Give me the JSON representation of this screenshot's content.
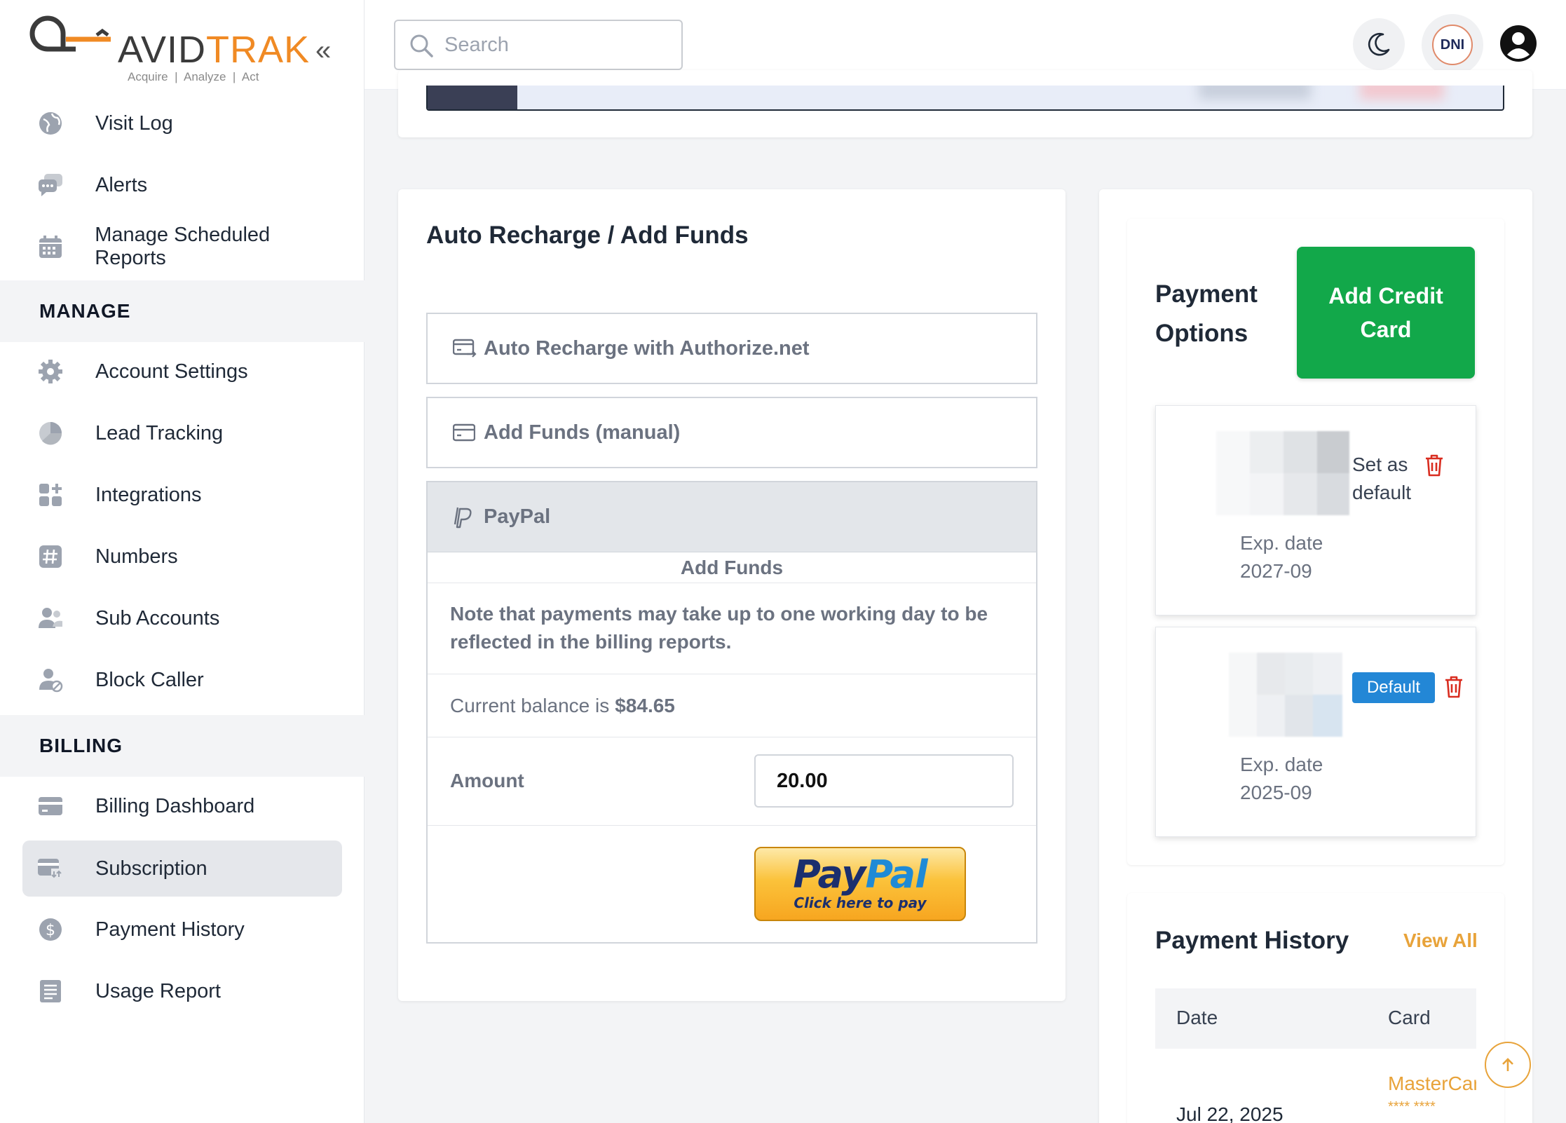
{
  "brand": {
    "name_part1": "AVID",
    "name_part2": "TRAK",
    "tagline": "Acquire  |  Analyze  |  Act"
  },
  "sidebar": {
    "collapse_label": "«",
    "top_items": [
      {
        "label": "Visit Log",
        "icon": "globe-icon"
      },
      {
        "label": "Alerts",
        "icon": "chat-bubbles-icon"
      },
      {
        "label": "Manage Scheduled Reports",
        "icon": "calendar-icon"
      }
    ],
    "manage_header": "MANAGE",
    "manage_items": [
      {
        "label": "Account Settings",
        "icon": "gear-icon"
      },
      {
        "label": "Lead Tracking",
        "icon": "pie-chart-icon"
      },
      {
        "label": "Integrations",
        "icon": "apps-icon"
      },
      {
        "label": "Numbers",
        "icon": "hash-icon"
      },
      {
        "label": "Sub Accounts",
        "icon": "users-icon"
      },
      {
        "label": "Block Caller",
        "icon": "user-block-icon"
      }
    ],
    "billing_header": "BILLING",
    "billing_items": [
      {
        "label": "Billing Dashboard",
        "icon": "credit-card-icon"
      },
      {
        "label": "Subscription",
        "icon": "card-transfer-icon",
        "active": true
      },
      {
        "label": "Payment History",
        "icon": "dollar-circle-icon"
      },
      {
        "label": "Usage Report",
        "icon": "list-icon"
      }
    ]
  },
  "topbar": {
    "search_placeholder": "Search",
    "dni_label": "DNI"
  },
  "recharge": {
    "title": "Auto Recharge / Add Funds",
    "option_authorize": "Auto Recharge with Authorize.net",
    "option_manual": "Add Funds (manual)",
    "option_paypal": "PayPal",
    "paypal_sub": "Add Funds",
    "note": "Note that payments may take up to one working day to be reflected in the billing reports.",
    "balance_prefix": "Current balance is",
    "balance_value": "$84.65",
    "amount_label": "Amount",
    "amount_value": "20.00",
    "paypal_logo_1": "Pay",
    "paypal_logo_2": "Pal",
    "paypal_click": "Click here to pay"
  },
  "payment_options": {
    "title": "Payment Options",
    "add_button": "Add Credit Card",
    "cards": [
      {
        "set_default_label": "Set as default",
        "exp_label": "Exp. date",
        "exp_value": "2027-09",
        "is_default": false
      },
      {
        "default_badge": "Default",
        "exp_label": "Exp. date",
        "exp_value": "2025-09",
        "is_default": true
      }
    ]
  },
  "payment_history": {
    "title": "Payment History",
    "view_all": "View All",
    "columns": [
      "Date",
      "Card"
    ],
    "rows": [
      {
        "date": "Jul 22, 2025",
        "card": "MasterCard",
        "mask": "**** ****"
      }
    ]
  },
  "colors": {
    "accent_orange": "#f08a24",
    "add_card_green": "#12a84a",
    "default_badge_blue": "#2387d6",
    "link_orange": "#e8a33a",
    "delete_red": "#d92d20"
  }
}
